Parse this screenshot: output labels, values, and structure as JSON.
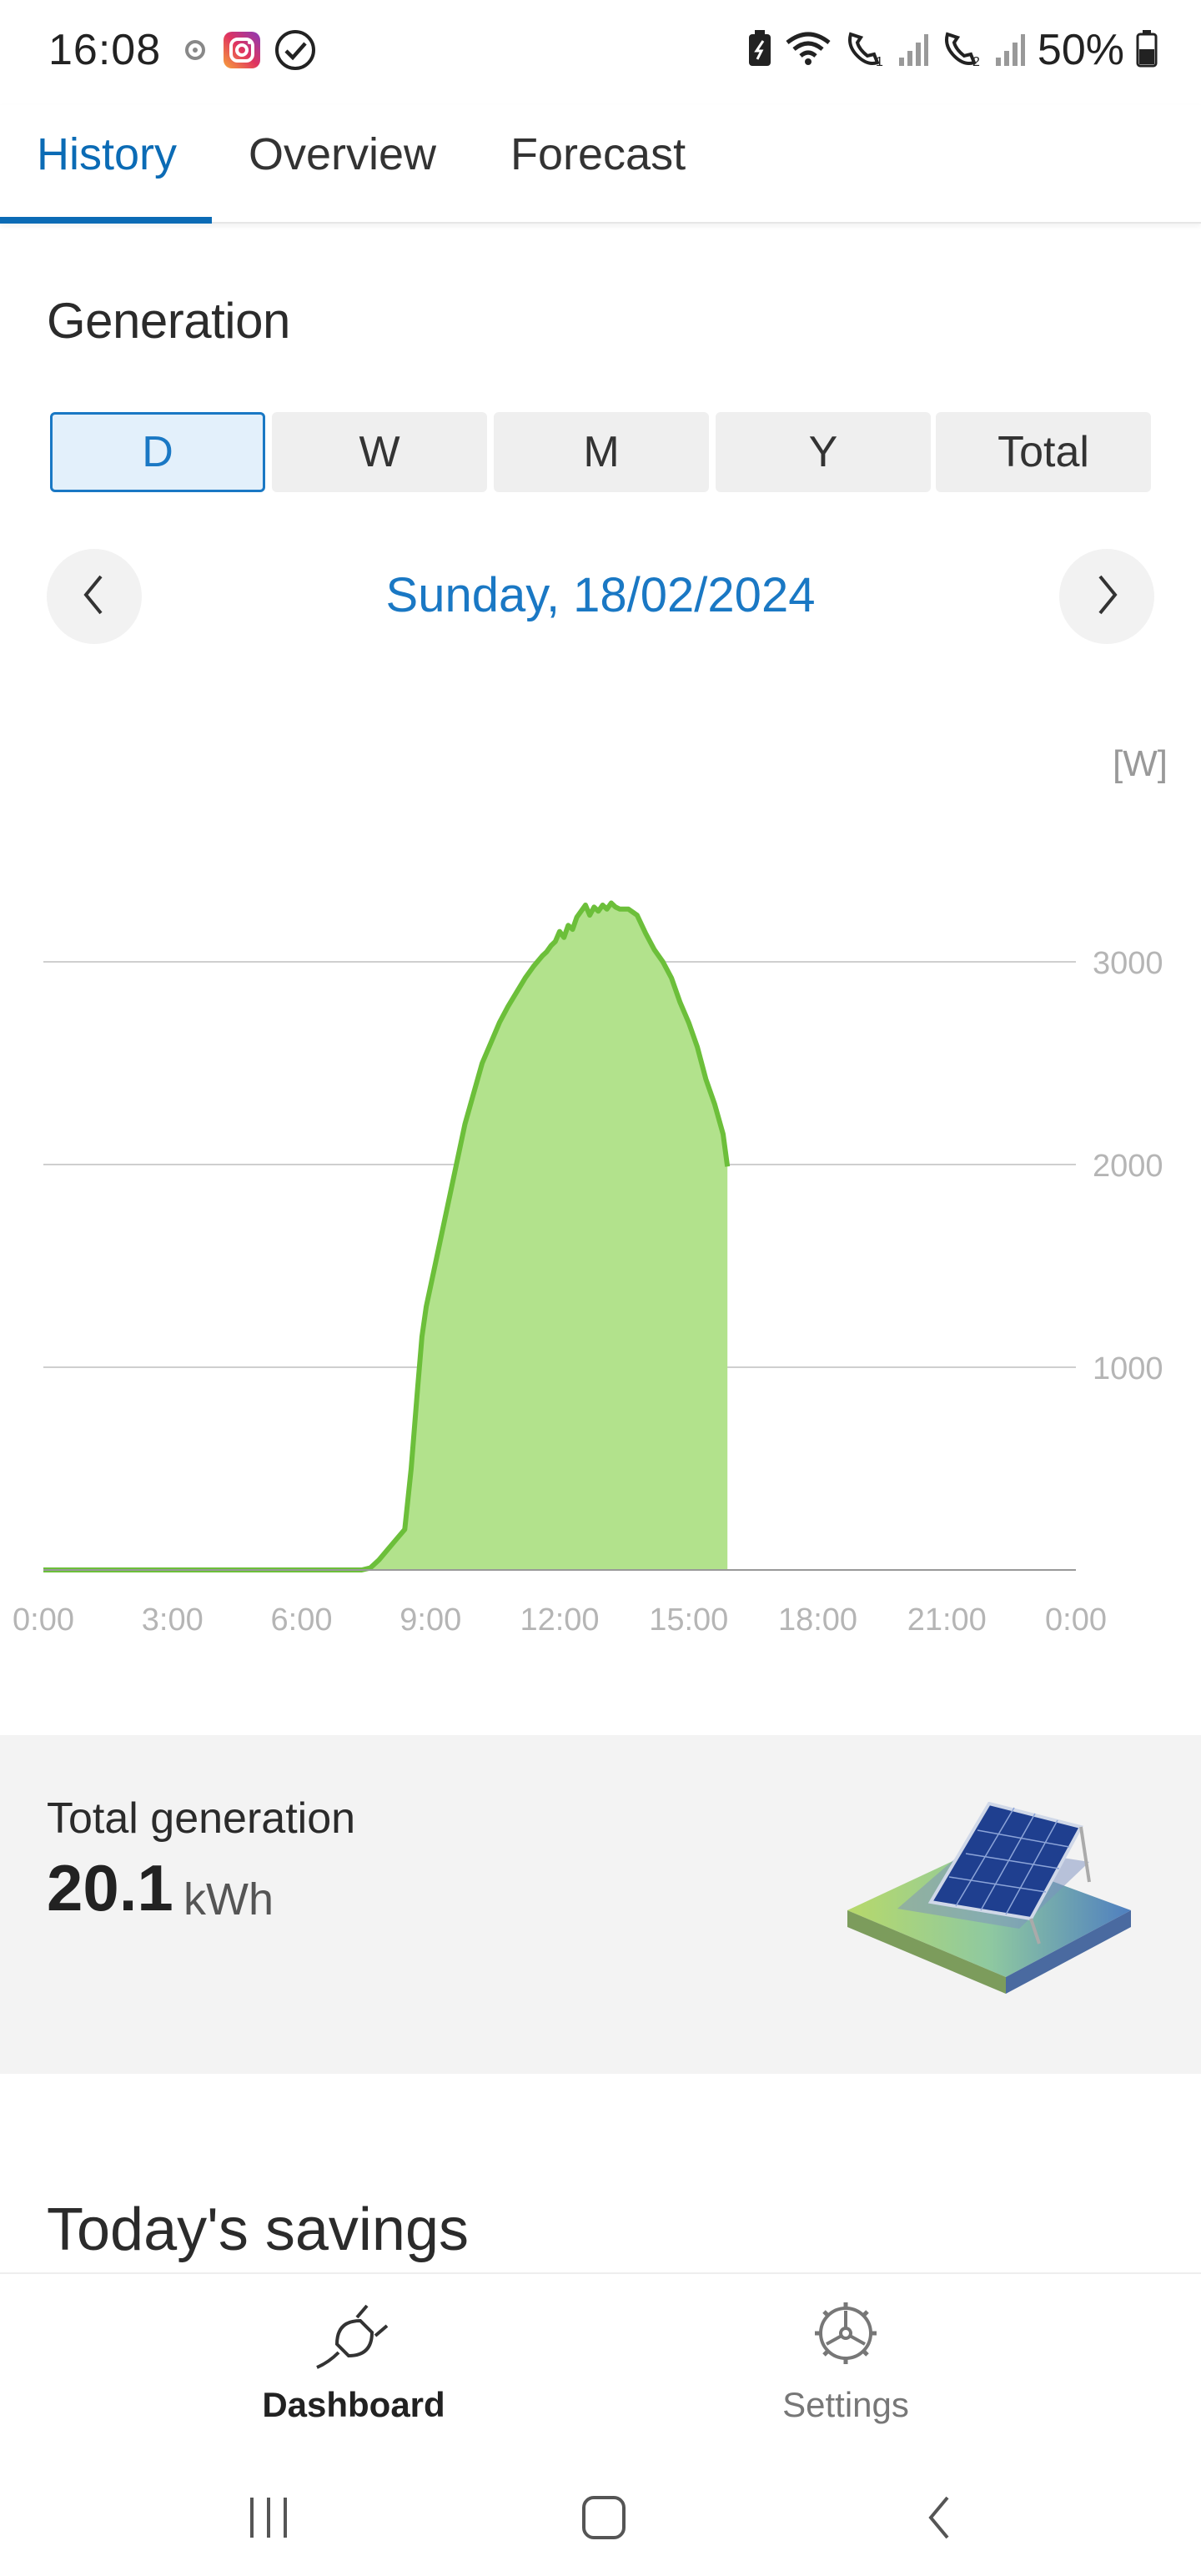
{
  "status_bar": {
    "time": "16:08",
    "battery_percent": "50%",
    "left_icons": [
      "nfc-icon",
      "instagram-icon",
      "check-circle-icon"
    ],
    "right_icons": [
      "battery-saver-icon",
      "wifi-icon",
      "call-sim1-icon",
      "signal-icon",
      "call-sim2-icon",
      "signal-icon",
      "battery-icon"
    ]
  },
  "tabs": [
    {
      "label": "History",
      "active": true
    },
    {
      "label": "Overview",
      "active": false
    },
    {
      "label": "Forecast",
      "active": false
    }
  ],
  "section": {
    "title": "Generation"
  },
  "periods": [
    {
      "label": "D",
      "active": true
    },
    {
      "label": "W",
      "active": false
    },
    {
      "label": "M",
      "active": false
    },
    {
      "label": "Y",
      "active": false
    },
    {
      "label": "Total",
      "active": false
    }
  ],
  "date_nav": {
    "date": "Sunday, 18/02/2024"
  },
  "chart_data": {
    "type": "area",
    "unit_label": "[W]",
    "x_ticks": [
      "0:00",
      "3:00",
      "6:00",
      "9:00",
      "12:00",
      "15:00",
      "18:00",
      "21:00",
      "0:00"
    ],
    "y_ticks": [
      "1000",
      "2000",
      "3000"
    ],
    "xlim_hours": [
      0,
      24
    ],
    "ylim": [
      0,
      3300
    ],
    "grid": true,
    "color_line": "#6cbf3a",
    "color_fill": "#b2e28c",
    "series": [
      {
        "x_hours": [
          0,
          1,
          2,
          3,
          4,
          5,
          6,
          7,
          7.4,
          7.6,
          7.8,
          8.0,
          8.2,
          8.4,
          8.55,
          8.7,
          8.8,
          8.9,
          9.0,
          9.2,
          9.4,
          9.6,
          9.8,
          10.0,
          10.2,
          10.4,
          10.6,
          10.8,
          11.0,
          11.2,
          11.4,
          11.6,
          11.7,
          11.8,
          11.9,
          12.0,
          12.1,
          12.2,
          12.3,
          12.4,
          12.5,
          12.6,
          12.7,
          12.8,
          12.9,
          13.0,
          13.1,
          13.2,
          13.3,
          13.4,
          13.6,
          13.8,
          14.0,
          14.2,
          14.4,
          14.6,
          14.8,
          15.0,
          15.2,
          15.4,
          15.6,
          15.8,
          15.9
        ],
        "values": [
          0,
          0,
          0,
          0,
          0,
          0,
          0,
          0,
          0,
          10,
          50,
          100,
          150,
          200,
          500,
          900,
          1150,
          1300,
          1400,
          1600,
          1800,
          2000,
          2200,
          2350,
          2500,
          2600,
          2700,
          2780,
          2850,
          2920,
          2980,
          3030,
          3050,
          3080,
          3100,
          3150,
          3120,
          3180,
          3160,
          3220,
          3250,
          3280,
          3230,
          3270,
          3250,
          3280,
          3260,
          3290,
          3270,
          3260,
          3260,
          3230,
          3140,
          3060,
          3000,
          2920,
          2800,
          2700,
          2580,
          2420,
          2300,
          2150,
          1990
        ]
      }
    ]
  },
  "total": {
    "label": "Total generation",
    "value": "20.1",
    "unit": "kWh"
  },
  "savings": {
    "title": "Today's savings"
  },
  "bottom_nav": [
    {
      "label": "Dashboard",
      "icon": "plug-icon",
      "active": true
    },
    {
      "label": "Settings",
      "icon": "gear-icon",
      "active": false
    }
  ],
  "system_nav": [
    "recent-apps-icon",
    "home-icon",
    "back-icon"
  ]
}
